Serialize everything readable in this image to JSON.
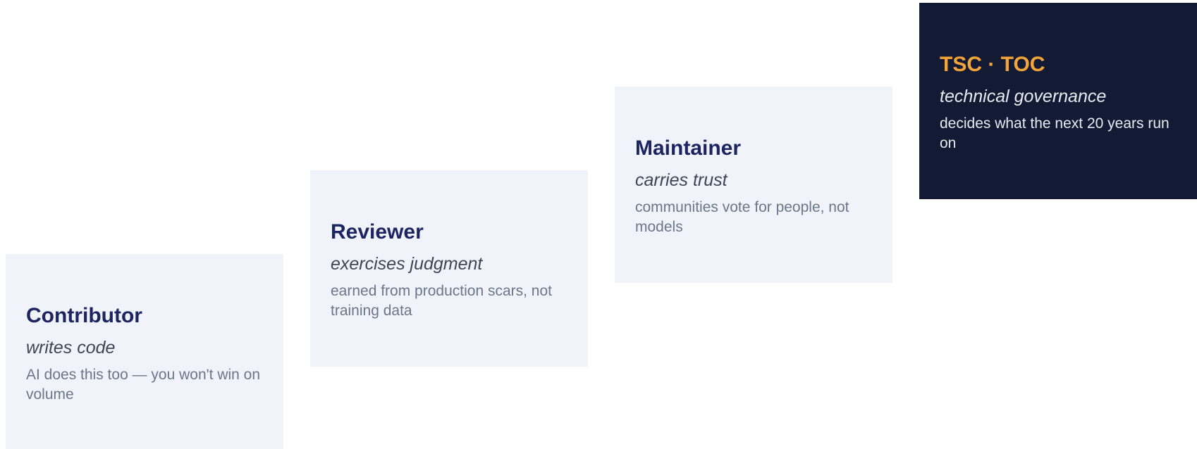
{
  "steps": [
    {
      "title": "Contributor",
      "role": "writes code",
      "description": "AI does this too — you won't win on volume"
    },
    {
      "title": "Reviewer",
      "role": "exercises judgment",
      "description": "earned from production scars, not training data"
    },
    {
      "title": "Maintainer",
      "role": "carries trust",
      "description": "communities vote for people, not models"
    },
    {
      "title": "TSC · TOC",
      "role": "technical governance",
      "description": "decides what the next 20 years run on"
    }
  ],
  "colors": {
    "light_card_bg": "#f0f3fa",
    "dark_card_bg": "#121b33",
    "title_navy": "#1e2461",
    "title_accent_orange": "#f5a43a",
    "role_text": "#3f4653",
    "desc_text": "#6b7688",
    "dark_card_text": "#e6ebf5"
  }
}
